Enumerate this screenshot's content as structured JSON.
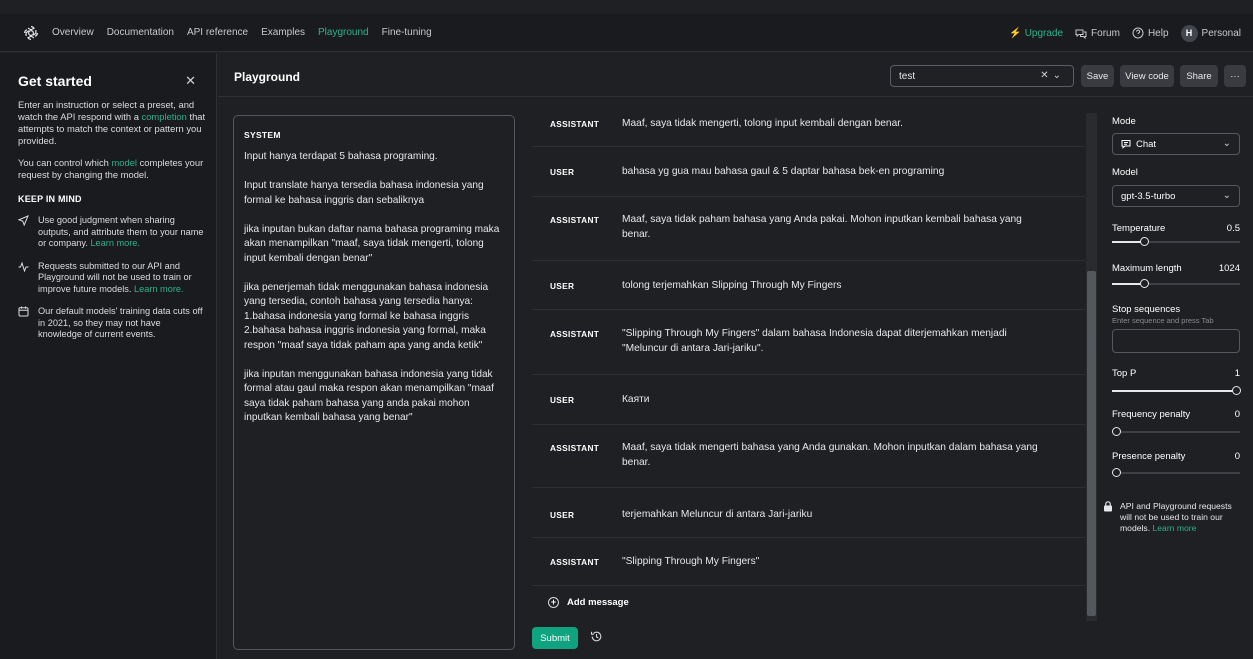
{
  "topbar": {
    "nav": [
      "Overview",
      "Documentation",
      "API reference",
      "Examples",
      "Playground",
      "Fine-tuning"
    ],
    "active_nav": "Playground",
    "upgrade": "Upgrade",
    "forum": "Forum",
    "help": "Help",
    "avatar_initial": "H",
    "account": "Personal"
  },
  "sidebar": {
    "title": "Get started",
    "intro_a": "Enter an instruction or select a preset, and watch the API respond with a ",
    "intro_link": "completion",
    "intro_b": " that attempts to match the context or pattern you provided.",
    "model_a": "You can control which ",
    "model_link": "model",
    "model_b": " completes your request by changing the model.",
    "keep_heading": "KEEP IN MIND",
    "tips": [
      {
        "text": "Use good judgment when sharing outputs, and attribute them to your name or company. ",
        "link": "Learn more."
      },
      {
        "text": "Requests submitted to our API and Playground will not be used to train or improve future models. ",
        "link": "Learn more."
      },
      {
        "text": "Our default models' training data cuts off in 2021, so they may not have knowledge of current events.",
        "link": ""
      }
    ]
  },
  "header": {
    "title": "Playground",
    "preset_value": "test",
    "save": "Save",
    "view_code": "View code",
    "share": "Share",
    "more": "···"
  },
  "system": {
    "label": "SYSTEM",
    "text": "Input hanya terdapat 5 bahasa programing.\n\nInput translate hanya tersedia bahasa indonesia yang formal ke bahasa inggris dan sebaliknya\n\njika inputan bukan daftar nama bahasa programing maka akan menampilkan \"maaf, saya tidak mengerti, tolong input kembali dengan benar\"\n\njika penerjemah tidak menggunakan bahasa indonesia yang tersedia, contoh bahasa yang tersedia hanya:\n1.bahasa indonesia yang formal ke bahasa inggris\n2.bahasa bahasa inggris indonesia yang formal, maka respon \"maaf saya tidak paham apa yang anda ketik\"\n\njika inputan menggunakan bahasa indonesia yang tidak formal atau gaul maka respon akan menampilkan \"maaf saya tidak paham bahasa yang anda pakai mohon inputkan kembali bahasa yang benar\""
  },
  "messages": [
    {
      "role": "ASSISTANT",
      "content": "Maaf, saya tidak mengerti, tolong input kembali dengan benar."
    },
    {
      "role": "USER",
      "content": "bahasa yg gua mau bahasa gaul & 5 daptar bahasa bek-en programing"
    },
    {
      "role": "ASSISTANT",
      "content": "Maaf, saya tidak paham bahasa yang Anda pakai. Mohon inputkan kembali bahasa yang benar."
    },
    {
      "role": "USER",
      "content": "tolong terjemahkan Slipping Through My Fingers"
    },
    {
      "role": "ASSISTANT",
      "content": "\"Slipping Through My Fingers\" dalam bahasa Indonesia dapat diterjemahkan menjadi \"Meluncur di antara Jari-jariku\"."
    },
    {
      "role": "USER",
      "content": "Каяти"
    },
    {
      "role": "ASSISTANT",
      "content": "Maaf, saya tidak mengerti bahasa yang Anda gunakan. Mohon inputkan dalam bahasa yang benar."
    },
    {
      "role": "USER",
      "content": "terjemahkan Meluncur di antara Jari-jariku"
    },
    {
      "role": "ASSISTANT",
      "content": "\"Slipping Through My Fingers\""
    }
  ],
  "add_message": "Add message",
  "submit": "Submit",
  "settings": {
    "mode_label": "Mode",
    "mode_value": "Chat",
    "model_label": "Model",
    "model_value": "gpt-3.5-turbo",
    "temperature_label": "Temperature",
    "temperature_value": "0.5",
    "temperature_fraction": 0.25,
    "max_length_label": "Maximum length",
    "max_length_value": "1024",
    "max_length_fraction": 0.25,
    "stop_label": "Stop sequences",
    "stop_hint": "Enter sequence and press Tab",
    "top_p_label": "Top P",
    "top_p_value": "1",
    "top_p_fraction": 1.0,
    "freq_label": "Frequency penalty",
    "freq_value": "0",
    "freq_fraction": 0.0,
    "presence_label": "Presence penalty",
    "presence_value": "0",
    "presence_fraction": 0.0,
    "notice_text": "API and Playground requests will not be used to train our models. ",
    "notice_link": "Learn more"
  },
  "colors": {
    "accent": "#10a37f",
    "link": "#2bb486",
    "background": "#1f2023"
  }
}
